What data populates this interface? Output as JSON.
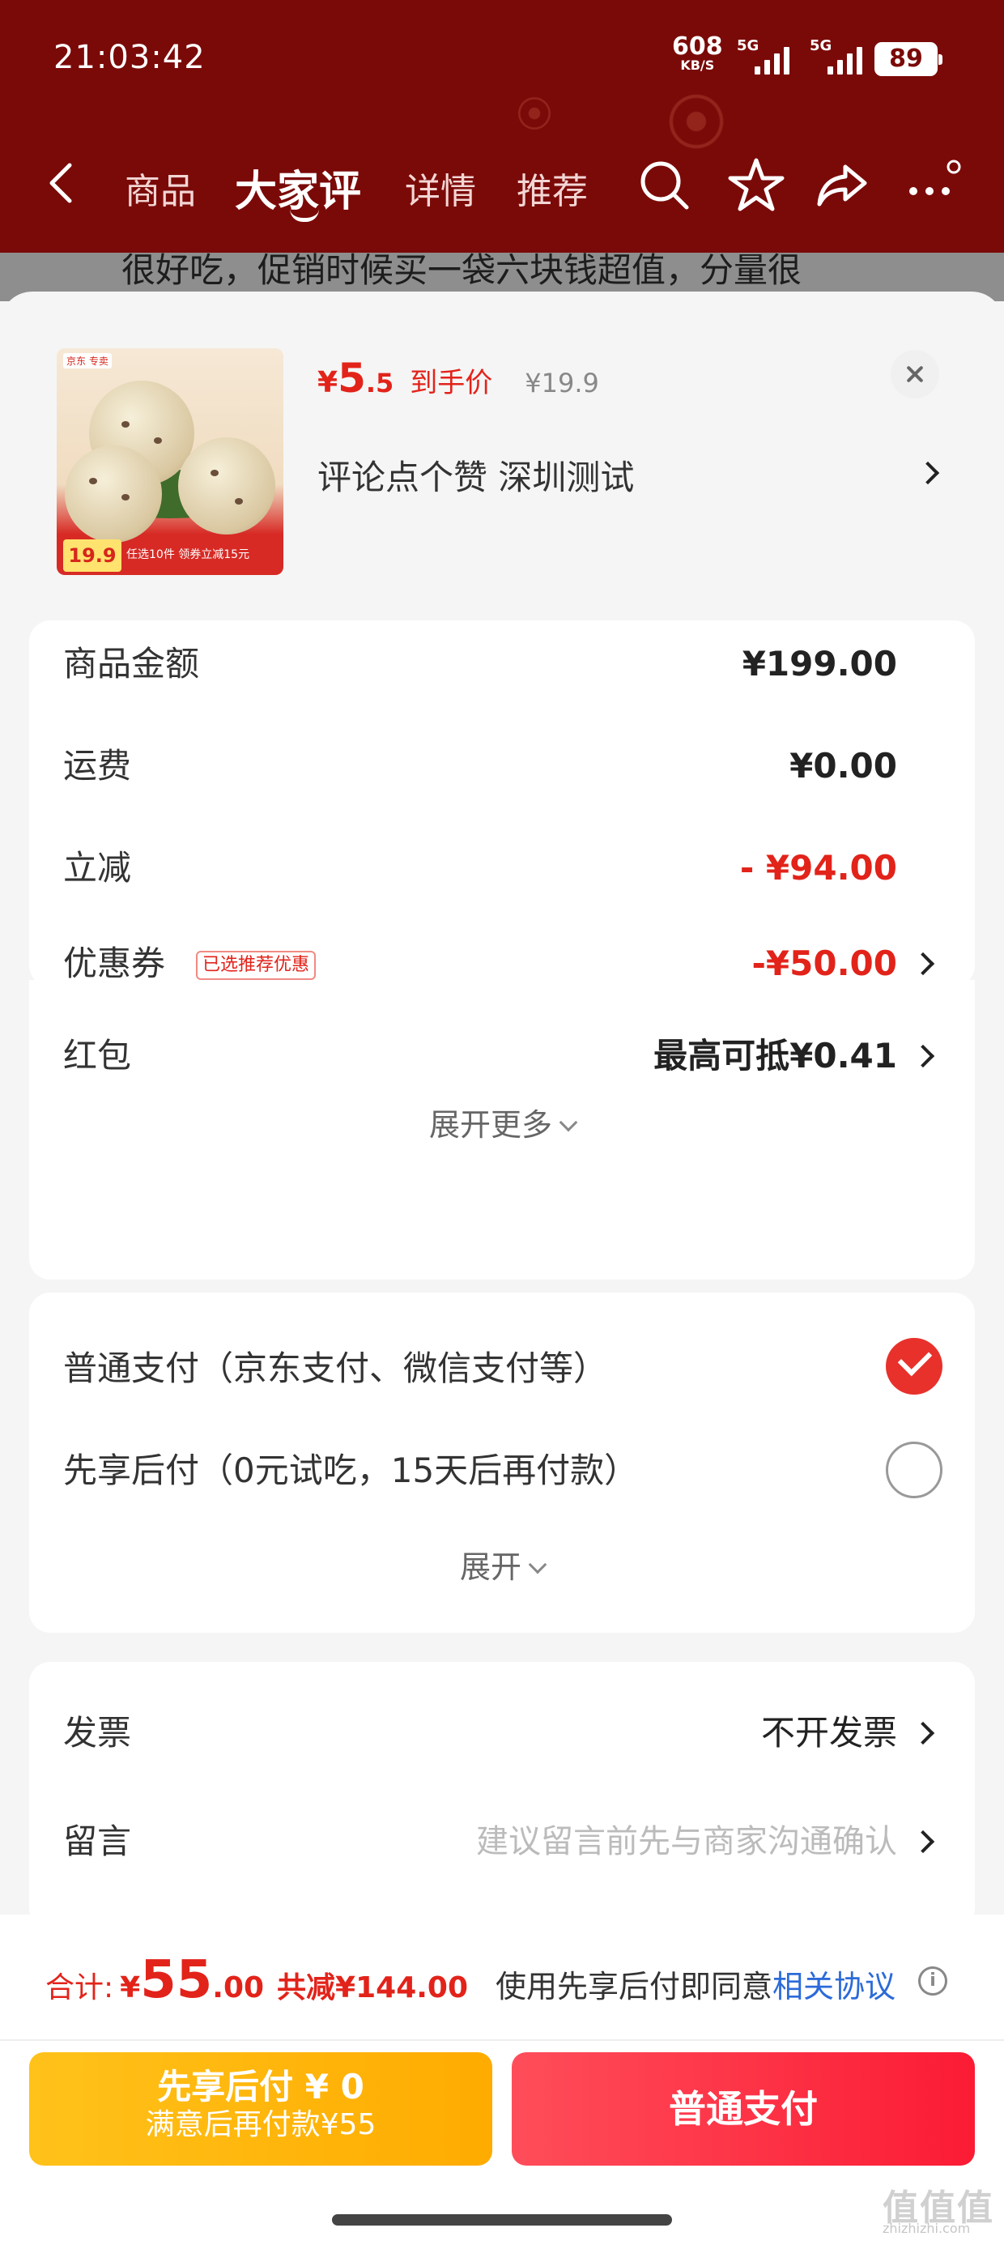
{
  "status_bar": {
    "time": "21:03:42",
    "net_speed": "608",
    "net_speed_unit": "KB/S",
    "signal1": "5G",
    "signal2": "5G",
    "battery": "89"
  },
  "nav": {
    "tabs": [
      "商品",
      "大家评",
      "详情",
      "推荐"
    ],
    "active_tab": "大家评",
    "icons": [
      "back-icon",
      "search-icon",
      "star-icon",
      "share-icon",
      "more-icon"
    ]
  },
  "background_text": "很好吃，促销时候买一袋六块钱超值，分量很",
  "product": {
    "price_currency": "¥",
    "price_int": "5",
    "price_dec": ".5",
    "price_tag": "到手价",
    "original_price": "¥19.9",
    "subtitle": "评论点个赞  深圳测试",
    "thumb_brand": "京东 专卖",
    "thumb_price": "19.9",
    "thumb_promo": "任选10件 领券立减15元"
  },
  "summary": {
    "rows": [
      {
        "label": "商品金额",
        "value": "¥199.00"
      },
      {
        "label": "运费",
        "value": "¥0.00"
      },
      {
        "label": "立减",
        "value": "- ¥94.00"
      },
      {
        "label": "优惠券",
        "badge": "已选推荐优惠",
        "value": "-¥50.00"
      },
      {
        "label": "红包",
        "value": "最高可抵¥0.41"
      }
    ],
    "expand_label": "展开更多"
  },
  "payment": {
    "options": [
      {
        "label": "普通支付（京东支付、微信支付等）",
        "selected": true
      },
      {
        "label": "先享后付（0元试吃，15天后再付款）",
        "selected": false
      }
    ],
    "expand_label": "展开"
  },
  "extras": {
    "invoice_label": "发票",
    "invoice_value": "不开发票",
    "message_label": "留言",
    "message_placeholder": "建议留言前先与商家沟通确认"
  },
  "footer": {
    "total_label": "合计:",
    "total_currency": "¥",
    "total_int": "55",
    "total_dec": ".00",
    "total_saved": "共减¥144.00",
    "agree_text": "使用先享后付即同意",
    "agree_link": "相关协议",
    "btn_later_line1": "先享后付 ¥ 0",
    "btn_later_line2": "满意后再付款¥55",
    "btn_pay": "普通支付"
  },
  "watermark": {
    "logo": "值值值",
    "site": "zhizhizhi.com"
  },
  "colors": {
    "header_bg": "#7a0a08",
    "accent_red": "#e2231a",
    "yellow_button": "#ffb400",
    "link_blue": "#2c6bd8"
  }
}
